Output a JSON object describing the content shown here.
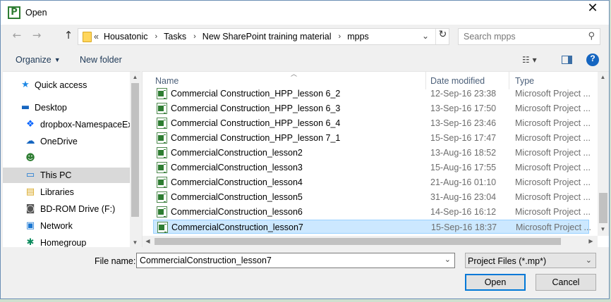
{
  "window": {
    "title": "Open",
    "app_icon": "P",
    "close_glyph": "✕"
  },
  "nav": {
    "back_glyph": "←",
    "forward_glyph": "→",
    "up_glyph": "↑",
    "breadcrumb_prefix": "«",
    "breadcrumbs": [
      "Housatonic",
      "Tasks",
      "New SharePoint training material",
      "mpps"
    ],
    "breadcrumb_sep": "›",
    "dropdown_glyph": "⌄",
    "refresh_glyph": "↻"
  },
  "search": {
    "placeholder": "Search mpps",
    "icon_glyph": "⚲"
  },
  "toolbar": {
    "organize_label": "Organize",
    "caret": "▼",
    "new_folder_label": "New folder",
    "view_glyph": "☷ ▾",
    "help_glyph": "?"
  },
  "sidebar": {
    "items": [
      {
        "label": "Quick access",
        "icon": "star-icon",
        "glyph": "★",
        "color": "#1e88e5"
      },
      {
        "label": "Desktop",
        "icon": "desktop-icon",
        "glyph": "▬",
        "color": "#1565c0"
      },
      {
        "label": "dropbox-NamespaceExt",
        "icon": "dropbox-icon",
        "glyph": "❖",
        "color": "#0061fe"
      },
      {
        "label": "OneDrive",
        "icon": "cloud-icon",
        "glyph": "☁",
        "color": "#1565c0"
      },
      {
        "label": "",
        "icon": "user-icon",
        "glyph": "☻",
        "color": "#2e7d32"
      },
      {
        "label": "This PC",
        "icon": "computer-icon",
        "glyph": "▭",
        "color": "#1976d2"
      },
      {
        "label": "Libraries",
        "icon": "libraries-icon",
        "glyph": "▤",
        "color": "#d9a824"
      },
      {
        "label": "BD-ROM Drive (F:)",
        "icon": "disc-drive-icon",
        "glyph": "◙",
        "color": "#555555"
      },
      {
        "label": "Network",
        "icon": "network-icon",
        "glyph": "▣",
        "color": "#1976d2"
      },
      {
        "label": "Homegroup",
        "icon": "homegroup-icon",
        "glyph": "✱",
        "color": "#0a8a5c"
      }
    ],
    "selected_index": 5,
    "scroll_up": "▲",
    "scroll_down": "▼"
  },
  "file_list": {
    "columns": {
      "name": "Name",
      "date": "Date modified",
      "type": "Type"
    },
    "sort_caret": "︿",
    "rows": [
      {
        "name": "Commercial Construction_HPP_lesson 6_2",
        "date": "12-Sep-16 23:38",
        "type": "Microsoft Project ..."
      },
      {
        "name": "Commercial Construction_HPP_lesson 6_3",
        "date": "13-Sep-16 17:50",
        "type": "Microsoft Project ..."
      },
      {
        "name": "Commercial Construction_HPP_lesson 6_4",
        "date": "13-Sep-16 23:46",
        "type": "Microsoft Project ..."
      },
      {
        "name": "Commercial Construction_HPP_lesson 7_1",
        "date": "15-Sep-16 17:47",
        "type": "Microsoft Project ..."
      },
      {
        "name": "CommercialConstruction_lesson2",
        "date": "13-Aug-16 18:52",
        "type": "Microsoft Project ..."
      },
      {
        "name": "CommercialConstruction_lesson3",
        "date": "15-Aug-16 17:55",
        "type": "Microsoft Project ..."
      },
      {
        "name": "CommercialConstruction_lesson4",
        "date": "21-Aug-16 01:10",
        "type": "Microsoft Project ..."
      },
      {
        "name": "CommercialConstruction_lesson5",
        "date": "31-Aug-16 23:04",
        "type": "Microsoft Project ..."
      },
      {
        "name": "CommercialConstruction_lesson6",
        "date": "14-Sep-16 16:12",
        "type": "Microsoft Project ..."
      },
      {
        "name": "CommercialConstruction_lesson7",
        "date": "15-Sep-16 18:37",
        "type": "Microsoft Project ..."
      }
    ],
    "selected_index": 9,
    "scroll_up": "▲",
    "scroll_down": "▼",
    "scroll_left": "◀",
    "scroll_right": "▶"
  },
  "footer": {
    "file_name_label": "File name:",
    "file_name_value": "CommercialConstruction_lesson7",
    "dropdown_glyph": "⌄",
    "file_type_value": "Project Files (*.mp*)",
    "open_label": "Open",
    "cancel_label": "Cancel"
  },
  "colors": {
    "selection": "#cce8ff",
    "accent": "#0078d7",
    "project_green": "#2e7d32"
  }
}
